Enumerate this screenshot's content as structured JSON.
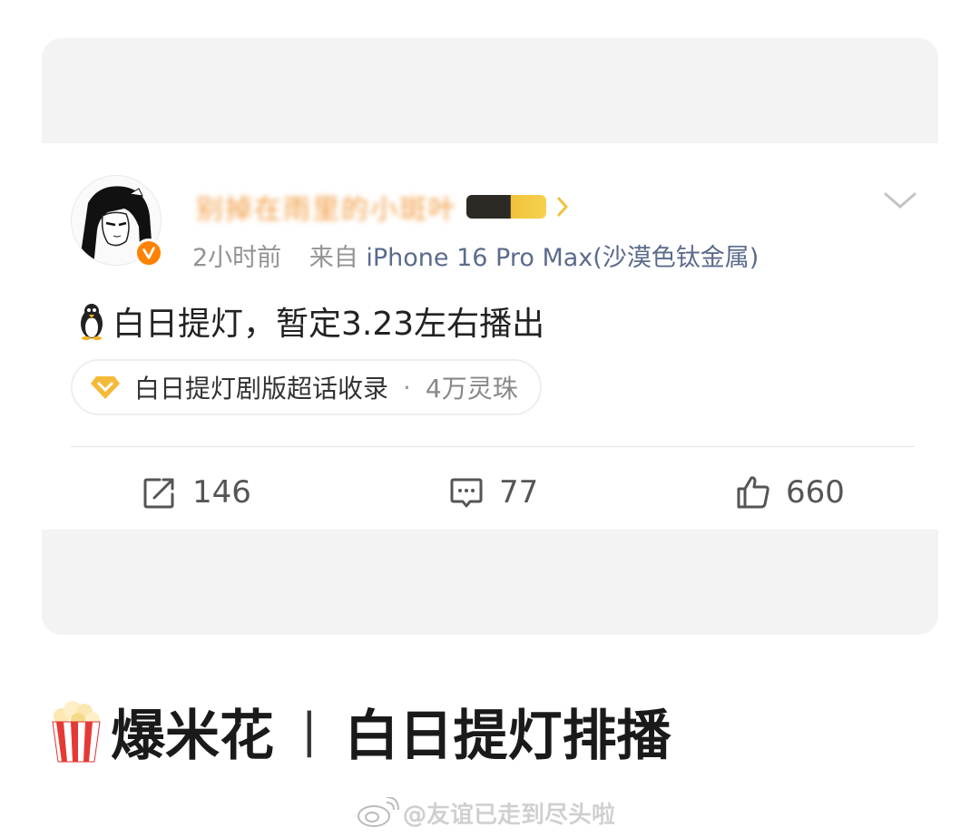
{
  "post": {
    "username": "别掉在雨里的小斑叶",
    "time": "2小时前",
    "source_prefix": "来自",
    "device": "iPhone 16 Pro Max(沙漠色钛金属)",
    "text": "白日提灯，暂定3.23左右播出",
    "topic": {
      "name": "白日提灯剧版超话收录",
      "separator": "·",
      "count": "4万灵珠"
    },
    "actions": {
      "repost": "146",
      "comment": "77",
      "like": "660"
    }
  },
  "headline": {
    "prefix": "爆米花",
    "separator": "|",
    "title": "白日提灯排播"
  },
  "watermark": {
    "text": "@友谊已走到尽头啦"
  },
  "colors": {
    "verified": "#ff8200",
    "username": "#f09a3e",
    "device": "#5b6b8c",
    "topic_icon": "#f5b93a"
  }
}
